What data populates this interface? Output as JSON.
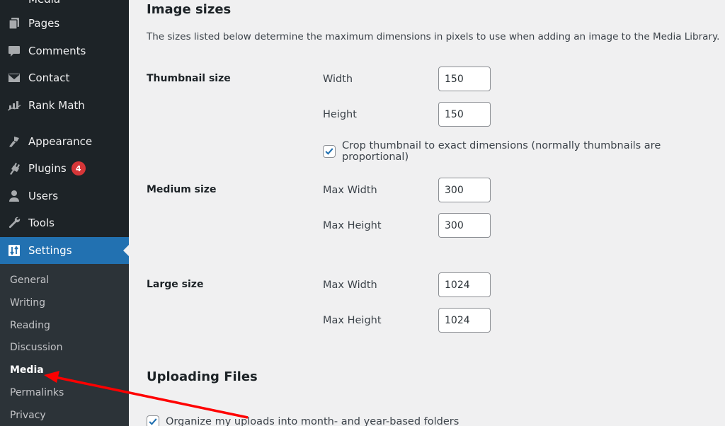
{
  "sidebar": {
    "items": [
      {
        "label": "Media",
        "icon": "media-icon"
      },
      {
        "label": "Pages",
        "icon": "pages-icon"
      },
      {
        "label": "Comments",
        "icon": "comments-icon"
      },
      {
        "label": "Contact",
        "icon": "envelope-icon"
      },
      {
        "label": "Rank Math",
        "icon": "rank-math-icon"
      },
      {
        "label": "Appearance",
        "icon": "paintbrush-icon"
      },
      {
        "label": "Plugins",
        "icon": "plugin-icon",
        "badge": "4"
      },
      {
        "label": "Users",
        "icon": "user-icon"
      },
      {
        "label": "Tools",
        "icon": "wrench-icon"
      },
      {
        "label": "Settings",
        "icon": "settings-icon",
        "active": true
      }
    ],
    "submenu": [
      {
        "label": "General"
      },
      {
        "label": "Writing"
      },
      {
        "label": "Reading"
      },
      {
        "label": "Discussion"
      },
      {
        "label": "Media",
        "current": true
      },
      {
        "label": "Permalinks"
      },
      {
        "label": "Privacy"
      }
    ]
  },
  "main": {
    "image_sizes": {
      "title": "Image sizes",
      "description": "The sizes listed below determine the maximum dimensions in pixels to use when adding an image to the Media Library.",
      "thumbnail": {
        "label": "Thumbnail size",
        "width_label": "Width",
        "width_value": "150",
        "height_label": "Height",
        "height_value": "150",
        "crop_label": "Crop thumbnail to exact dimensions (normally thumbnails are proportional)",
        "crop_checked": true
      },
      "medium": {
        "label": "Medium size",
        "width_label": "Max Width",
        "width_value": "300",
        "height_label": "Max Height",
        "height_value": "300"
      },
      "large": {
        "label": "Large size",
        "width_label": "Max Width",
        "width_value": "1024",
        "height_label": "Max Height",
        "height_value": "1024"
      }
    },
    "uploading": {
      "title": "Uploading Files",
      "organize_label": "Organize my uploads into month- and year-based folders",
      "organize_checked": true
    }
  },
  "colors": {
    "sidebar_bg": "#1d2327",
    "submenu_bg": "#2c3338",
    "active_bg": "#2271b1",
    "badge_bg": "#d63638",
    "content_bg": "#f0f0f1",
    "annotation_arrow": "#ff0000"
  }
}
